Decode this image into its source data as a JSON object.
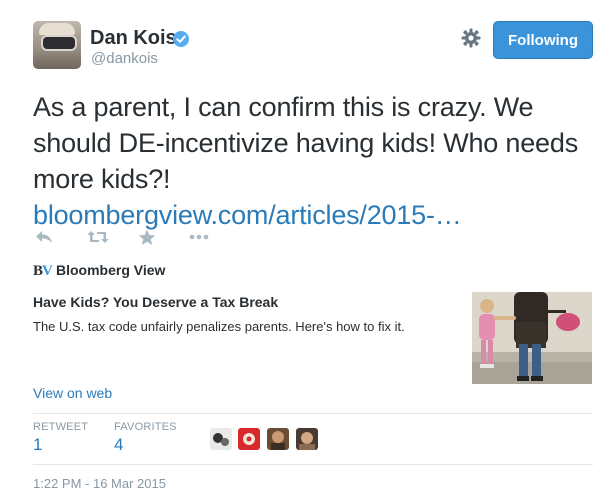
{
  "author": {
    "name": "Dan Kois",
    "handle": "@dankois",
    "verified": true
  },
  "header": {
    "follow_label": "Following",
    "settings_icon": "gear-icon"
  },
  "tweet": {
    "text": "As a parent, I can confirm this is crazy. We should DE-incentivize having kids! Who needs more kids?!",
    "link_text": "bloombergview.com/articles/2015-…"
  },
  "actions": [
    "reply-icon",
    "retweet-icon",
    "favorite-star-icon",
    "more-dots-icon"
  ],
  "card": {
    "source_logo": "BV",
    "source_name": "Bloomberg View",
    "title": "Have Kids? You Deserve a Tax Break",
    "description": "The U.S. tax code unfairly penalizes parents. Here's how to fix it.",
    "view_link": "View on web"
  },
  "stats": {
    "retweet_label": "RETWEET",
    "retweet_count": "1",
    "favorites_label": "FAVORITES",
    "favorites_count": "4"
  },
  "timestamp": "1:22 PM - 16 Mar 2015",
  "colors": {
    "link": "#2b7bb9",
    "button": "#3b94d9",
    "muted": "#8899a6",
    "text": "#292f33"
  }
}
